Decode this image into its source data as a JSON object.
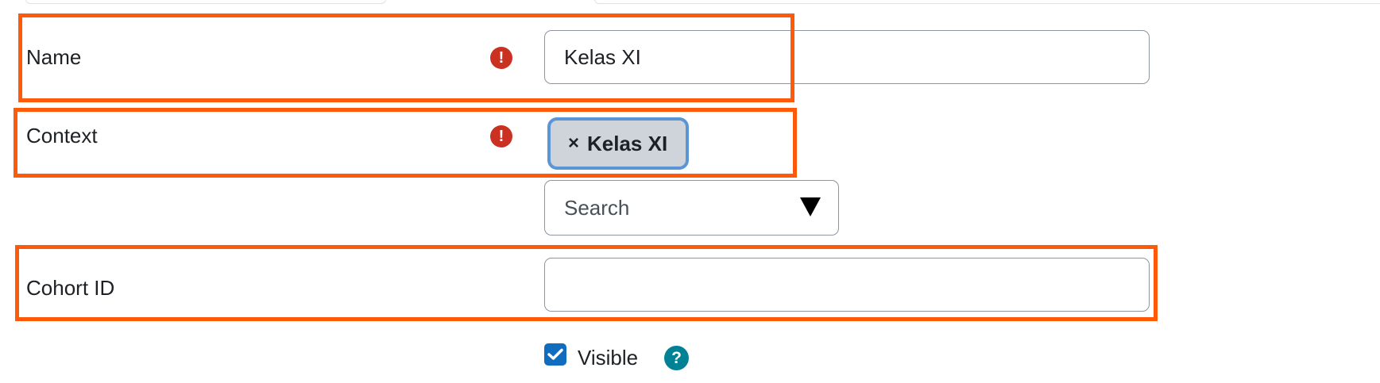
{
  "form": {
    "name": {
      "label": "Name",
      "required_icon": "exclamation-circle-icon",
      "value": "Kelas XI"
    },
    "context": {
      "label": "Context",
      "required_icon": "exclamation-circle-icon",
      "selected_tag": {
        "remove_glyph": "×",
        "label": "Kelas XI"
      },
      "search_placeholder": "Search",
      "dropdown_icon": "triangle-down-icon"
    },
    "cohort_id": {
      "label": "Cohort ID",
      "value": ""
    },
    "visible": {
      "label": "Visible",
      "checked": true,
      "help_icon": "question-circle-icon"
    }
  },
  "colors": {
    "required": "#ca3120",
    "highlight_box": "#ff5a0a",
    "checkbox": "#0f6cbf",
    "help": "#008196",
    "tag_border": "#5a96d5",
    "tag_background": "#ced4da"
  }
}
